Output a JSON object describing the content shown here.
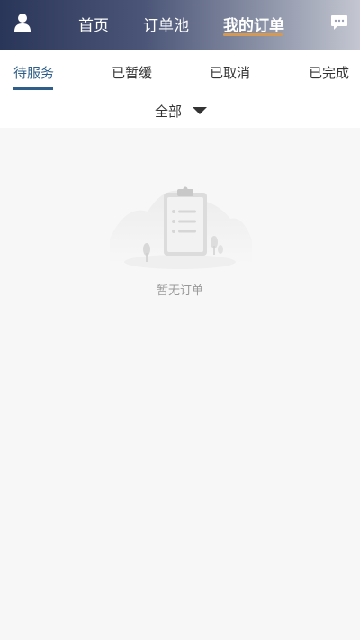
{
  "header": {
    "tabs": [
      {
        "label": "首页"
      },
      {
        "label": "订单池"
      },
      {
        "label": "我的订单"
      }
    ],
    "accent_color": "#d49a55",
    "avatar_icon": "user-icon",
    "message_icon": "chat-bubble-icon"
  },
  "status_tabs": [
    {
      "label": "待服务"
    },
    {
      "label": "已暂缓"
    },
    {
      "label": "已取消"
    },
    {
      "label": "已完成"
    }
  ],
  "active_status_color": "#2f5f88",
  "filter": {
    "selected": "全部"
  },
  "empty_state": {
    "text": "暂无订单",
    "icon": "clipboard-empty-icon"
  }
}
